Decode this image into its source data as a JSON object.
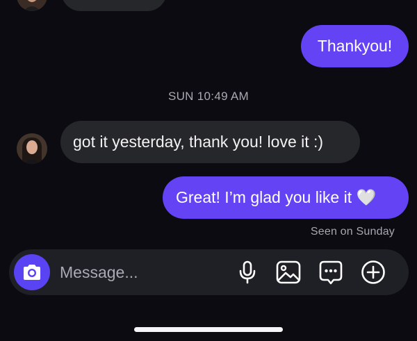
{
  "conversation": {
    "messages": [
      {
        "direction": "outgoing",
        "text": "Thankyou!"
      },
      {
        "direction": "incoming",
        "text": "got it yesterday, thank you! love it :)"
      },
      {
        "direction": "outgoing",
        "text": "Great! I’m glad you like it 🤍"
      }
    ],
    "timestamp": "SUN 10:49 AM",
    "seen_status": "Seen on Sunday"
  },
  "composer": {
    "placeholder": "Message...",
    "icons": [
      "camera-icon",
      "microphone-icon",
      "image-icon",
      "sticker-chat-icon",
      "add-icon"
    ]
  },
  "colors": {
    "background": "#0b0b11",
    "incoming_bubble": "#26272b",
    "outgoing_bubble": "#6443f5",
    "camera_button": "#5a43f2"
  }
}
